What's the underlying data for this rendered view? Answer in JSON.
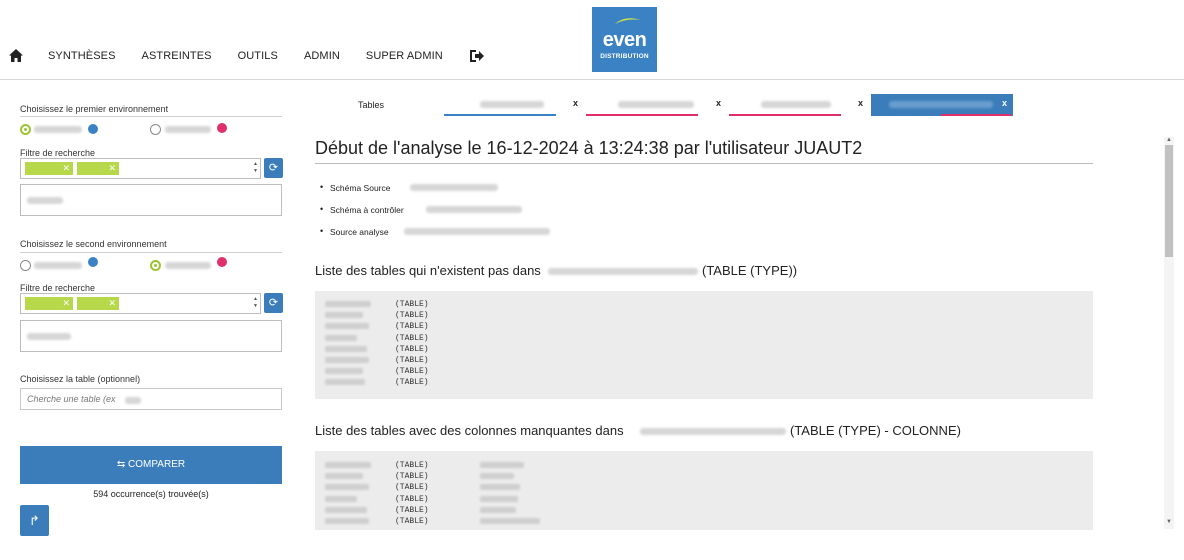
{
  "nav": {
    "items": [
      "SYNTHÈSES",
      "ASTREINTES",
      "OUTILS",
      "ADMIN",
      "SUPER ADMIN"
    ],
    "home_icon": "home-icon",
    "logout_icon": "logout-icon"
  },
  "logo": {
    "brand": "even",
    "sub": "DISTRIBUTION",
    "color": "#3b82c4"
  },
  "left": {
    "env1_label": "Choisissez le premier environnement",
    "env2_label": "Choisissez le second environnement",
    "filter1_label": "Filtre de recherche",
    "filter2_label": "Filtre de recherche",
    "table_label": "Choisissez la table (optionnel)",
    "table_placeholder": "Cherche une table (ex",
    "compare_label": "⇆ COMPARER",
    "count_text": "594 occurrence(s) trouvée(s)",
    "env_dot_colors": [
      "#3b82c4",
      "#e0306a"
    ]
  },
  "tabs": {
    "label": "Tables",
    "close": "x"
  },
  "main": {
    "title": "Début de l'analyse le 16-12-2024 à 13:24:38 par l'utilisateur JUAUT2",
    "bullets": [
      "Schéma Source",
      "Schéma à contrôler",
      "Source analyse"
    ],
    "section1": "Liste des tables qui n'existent pas dans",
    "section1_suffix": "(TABLE (TYPE))",
    "section2": "Liste des tables avec des colonnes manquantes dans",
    "section2_suffix": "(TABLE (TYPE) - COLONNE)",
    "type_label": "(TABLE)",
    "rows1": 8,
    "rows2": 6
  }
}
